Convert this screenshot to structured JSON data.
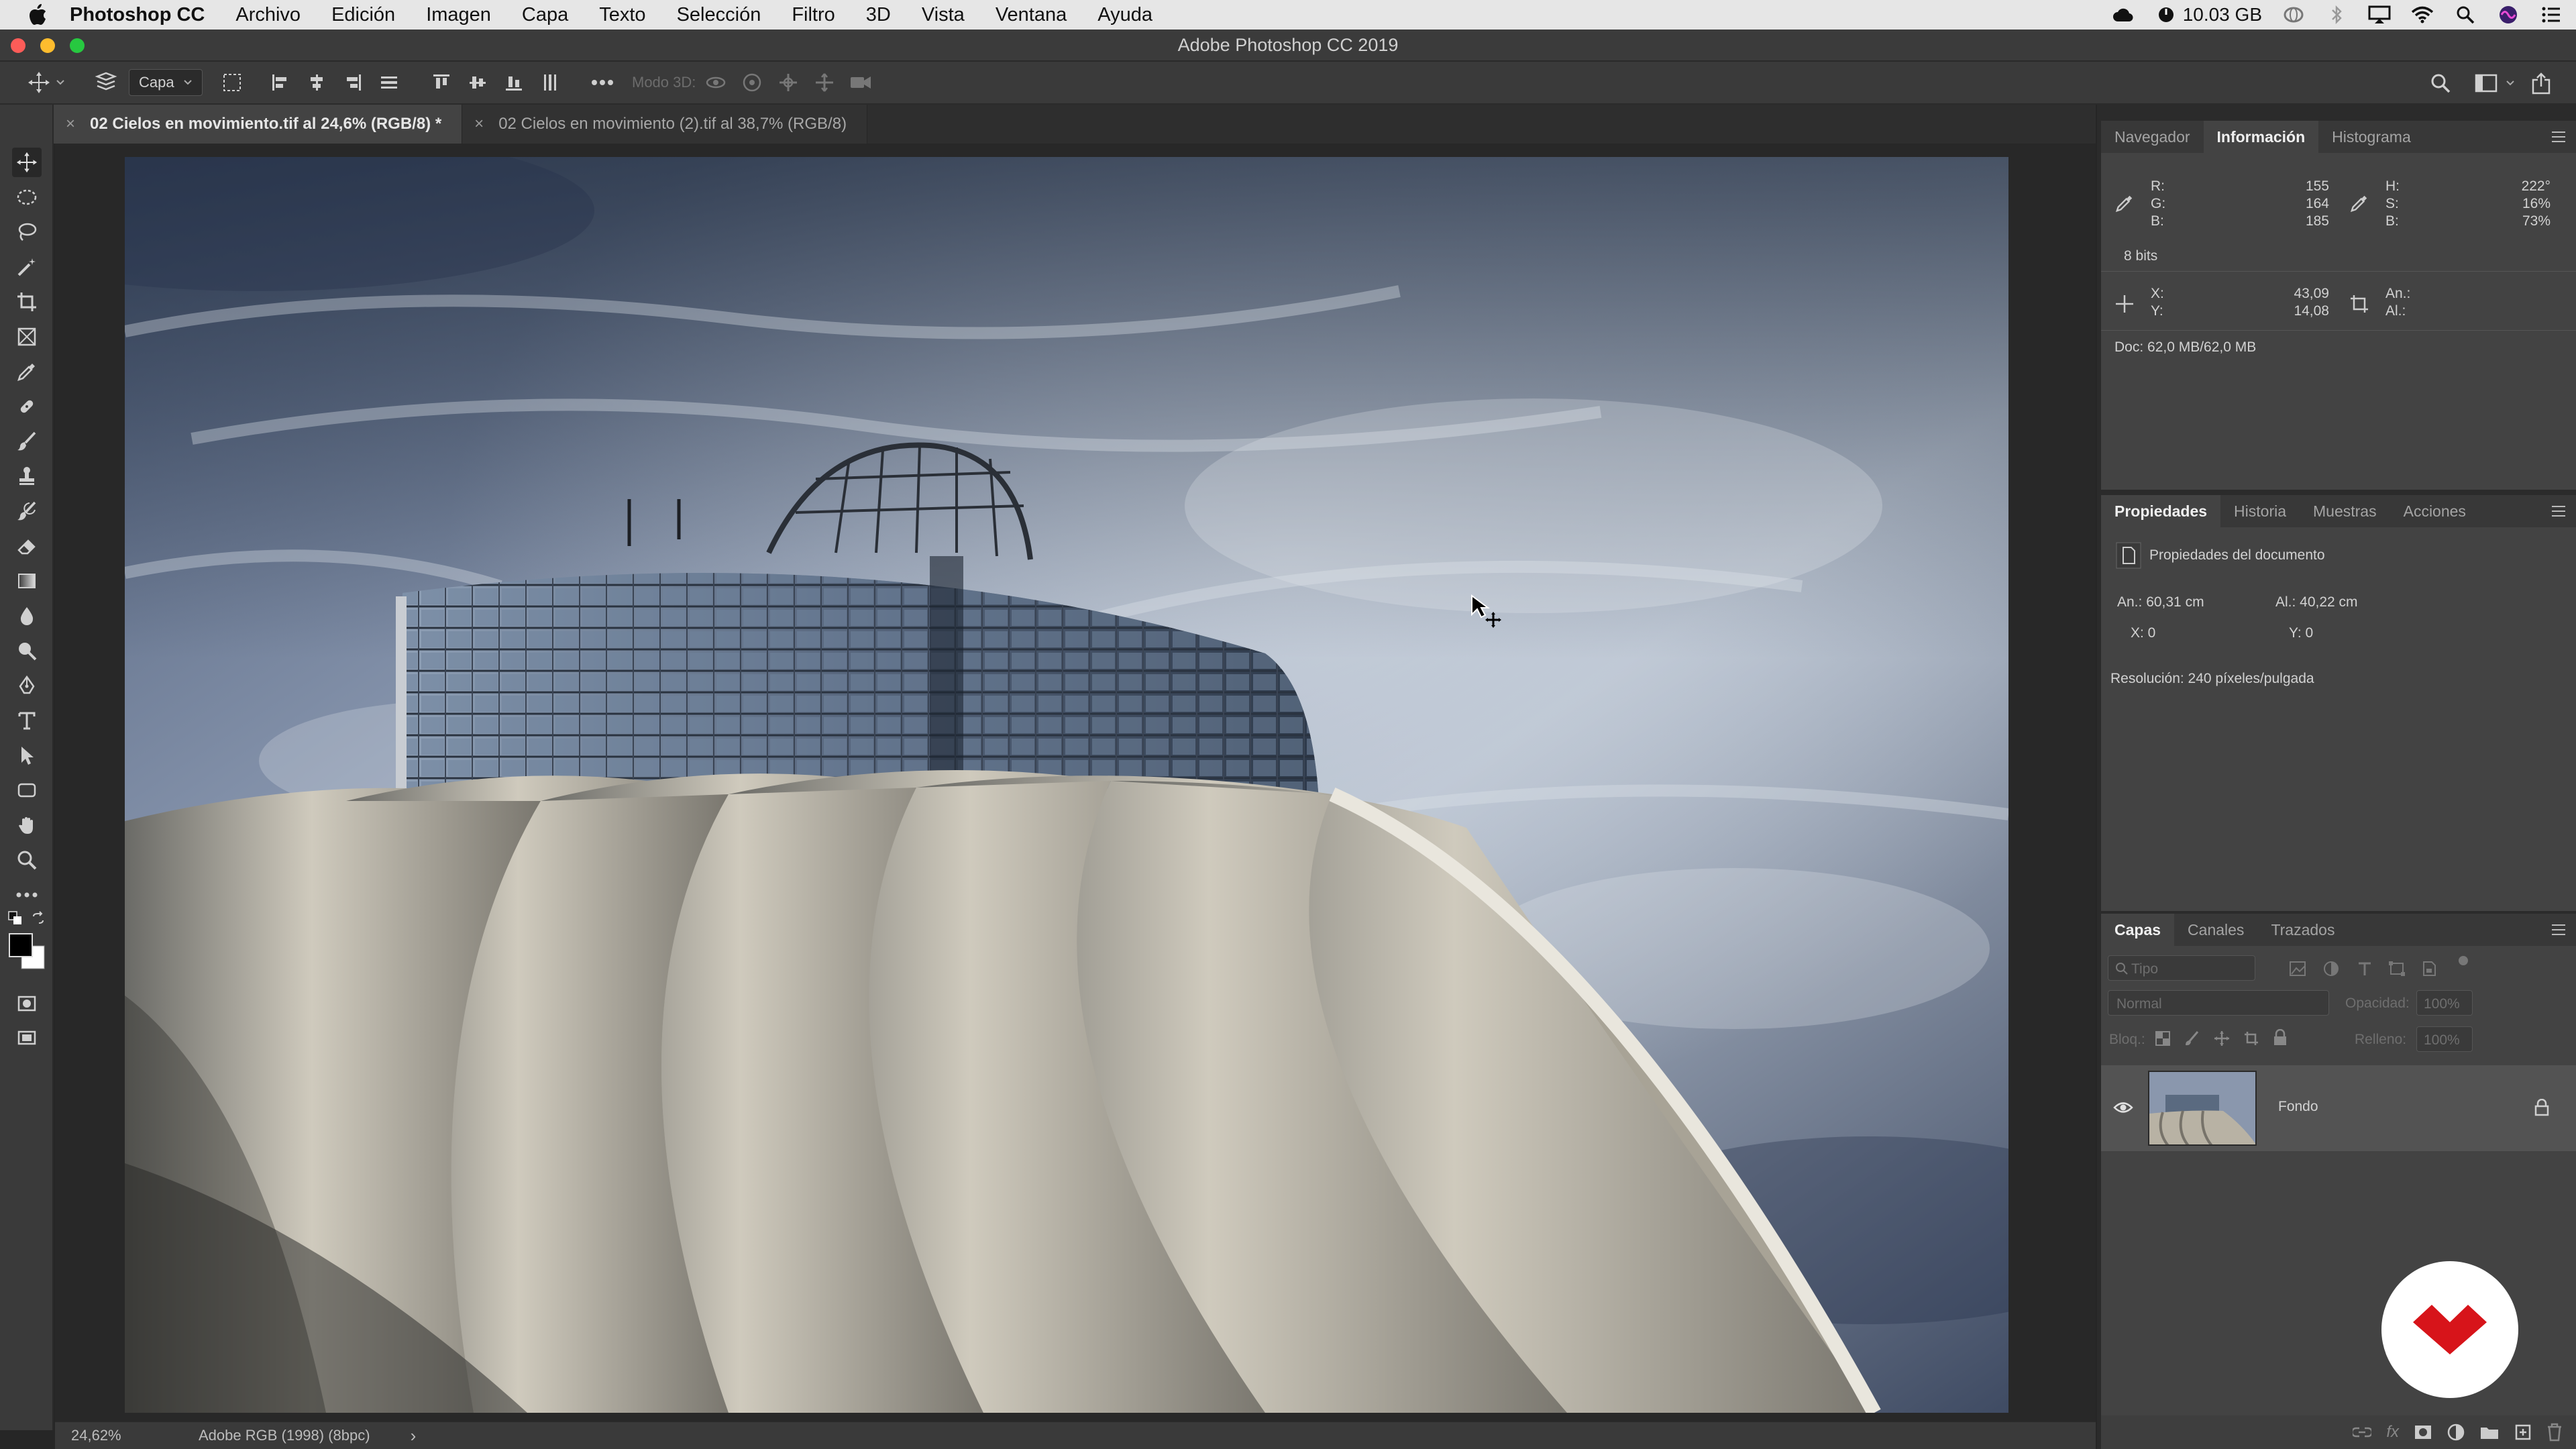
{
  "menubar": {
    "app_name": "Photoshop CC",
    "items": [
      "Archivo",
      "Edición",
      "Imagen",
      "Capa",
      "Texto",
      "Selección",
      "Filtro",
      "3D",
      "Vista",
      "Ventana",
      "Ayuda"
    ],
    "memory": "10.03 GB"
  },
  "window": {
    "title": "Adobe Photoshop CC 2019"
  },
  "options_bar": {
    "layer_select": "Capa",
    "mode_3d_label": "Modo 3D:"
  },
  "tabs": [
    {
      "label": "02 Cielos en movimiento.tif al 24,6% (RGB/8) *",
      "active": true
    },
    {
      "label": "02 Cielos en movimiento (2).tif al 38,7% (RGB/8)",
      "active": false
    }
  ],
  "status": {
    "zoom": "24,62%",
    "profile": "Adobe RGB (1998) (8bpc)",
    "arrow": "›"
  },
  "info_panel": {
    "tabs": [
      "Navegador",
      "Información",
      "Histograma"
    ],
    "active_tab": "Información",
    "rgb": {
      "r_label": "R:",
      "g_label": "G:",
      "b_label": "B:",
      "r": "155",
      "g": "164",
      "b": "185"
    },
    "hsb": {
      "h_label": "H:",
      "s_label": "S:",
      "b_label": "B:",
      "h": "222°",
      "s": "16%",
      "b": "73%"
    },
    "bits": "8 bits",
    "xy": {
      "x_label": "X:",
      "y_label": "Y:",
      "x": "43,09",
      "y": "14,08"
    },
    "wh": {
      "w_label": "An.:",
      "h_label": "Al.:"
    },
    "doc": "Doc: 62,0 MB/62,0 MB"
  },
  "properties_panel": {
    "tabs": [
      "Propiedades",
      "Historia",
      "Muestras",
      "Acciones"
    ],
    "active_tab": "Propiedades",
    "heading": "Propiedades del documento",
    "width": "An.: 60,31 cm",
    "height": "Al.: 40,22 cm",
    "x": "X: 0",
    "y": "Y: 0",
    "resolution": "Resolución: 240 píxeles/pulgada"
  },
  "layers_panel": {
    "tabs": [
      "Capas",
      "Canales",
      "Trazados"
    ],
    "active_tab": "Capas",
    "filter_placeholder": "Tipo",
    "blend_mode": "Normal",
    "opacity_label": "Opacidad:",
    "opacity_value": "100%",
    "lock_label": "Bloq.:",
    "fill_label": "Relleno:",
    "fill_value": "100%",
    "layers": [
      {
        "name": "Fondo",
        "visible": true,
        "locked": true
      }
    ]
  },
  "colors": {
    "accent": "#1473e6",
    "badge_red": "#d7141a",
    "panel_bg": "#434343"
  }
}
